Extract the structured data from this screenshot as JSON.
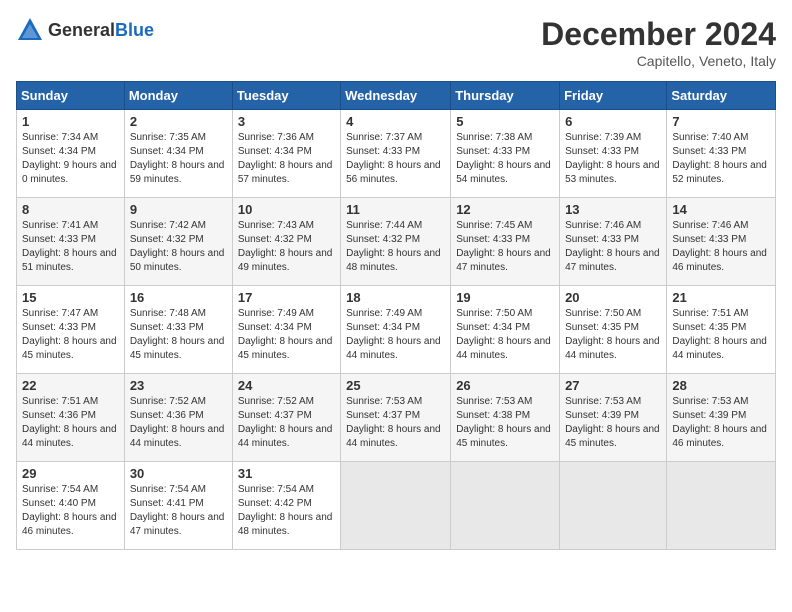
{
  "logo": {
    "text_general": "General",
    "text_blue": "Blue"
  },
  "title": "December 2024",
  "subtitle": "Capitello, Veneto, Italy",
  "headers": [
    "Sunday",
    "Monday",
    "Tuesday",
    "Wednesday",
    "Thursday",
    "Friday",
    "Saturday"
  ],
  "weeks": [
    [
      {
        "day": "1",
        "sunrise": "7:34 AM",
        "sunset": "4:34 PM",
        "daylight": "9 hours and 0 minutes."
      },
      {
        "day": "2",
        "sunrise": "7:35 AM",
        "sunset": "4:34 PM",
        "daylight": "8 hours and 59 minutes."
      },
      {
        "day": "3",
        "sunrise": "7:36 AM",
        "sunset": "4:34 PM",
        "daylight": "8 hours and 57 minutes."
      },
      {
        "day": "4",
        "sunrise": "7:37 AM",
        "sunset": "4:33 PM",
        "daylight": "8 hours and 56 minutes."
      },
      {
        "day": "5",
        "sunrise": "7:38 AM",
        "sunset": "4:33 PM",
        "daylight": "8 hours and 54 minutes."
      },
      {
        "day": "6",
        "sunrise": "7:39 AM",
        "sunset": "4:33 PM",
        "daylight": "8 hours and 53 minutes."
      },
      {
        "day": "7",
        "sunrise": "7:40 AM",
        "sunset": "4:33 PM",
        "daylight": "8 hours and 52 minutes."
      }
    ],
    [
      {
        "day": "8",
        "sunrise": "7:41 AM",
        "sunset": "4:33 PM",
        "daylight": "8 hours and 51 minutes."
      },
      {
        "day": "9",
        "sunrise": "7:42 AM",
        "sunset": "4:32 PM",
        "daylight": "8 hours and 50 minutes."
      },
      {
        "day": "10",
        "sunrise": "7:43 AM",
        "sunset": "4:32 PM",
        "daylight": "8 hours and 49 minutes."
      },
      {
        "day": "11",
        "sunrise": "7:44 AM",
        "sunset": "4:32 PM",
        "daylight": "8 hours and 48 minutes."
      },
      {
        "day": "12",
        "sunrise": "7:45 AM",
        "sunset": "4:33 PM",
        "daylight": "8 hours and 47 minutes."
      },
      {
        "day": "13",
        "sunrise": "7:46 AM",
        "sunset": "4:33 PM",
        "daylight": "8 hours and 47 minutes."
      },
      {
        "day": "14",
        "sunrise": "7:46 AM",
        "sunset": "4:33 PM",
        "daylight": "8 hours and 46 minutes."
      }
    ],
    [
      {
        "day": "15",
        "sunrise": "7:47 AM",
        "sunset": "4:33 PM",
        "daylight": "8 hours and 45 minutes."
      },
      {
        "day": "16",
        "sunrise": "7:48 AM",
        "sunset": "4:33 PM",
        "daylight": "8 hours and 45 minutes."
      },
      {
        "day": "17",
        "sunrise": "7:49 AM",
        "sunset": "4:34 PM",
        "daylight": "8 hours and 45 minutes."
      },
      {
        "day": "18",
        "sunrise": "7:49 AM",
        "sunset": "4:34 PM",
        "daylight": "8 hours and 44 minutes."
      },
      {
        "day": "19",
        "sunrise": "7:50 AM",
        "sunset": "4:34 PM",
        "daylight": "8 hours and 44 minutes."
      },
      {
        "day": "20",
        "sunrise": "7:50 AM",
        "sunset": "4:35 PM",
        "daylight": "8 hours and 44 minutes."
      },
      {
        "day": "21",
        "sunrise": "7:51 AM",
        "sunset": "4:35 PM",
        "daylight": "8 hours and 44 minutes."
      }
    ],
    [
      {
        "day": "22",
        "sunrise": "7:51 AM",
        "sunset": "4:36 PM",
        "daylight": "8 hours and 44 minutes."
      },
      {
        "day": "23",
        "sunrise": "7:52 AM",
        "sunset": "4:36 PM",
        "daylight": "8 hours and 44 minutes."
      },
      {
        "day": "24",
        "sunrise": "7:52 AM",
        "sunset": "4:37 PM",
        "daylight": "8 hours and 44 minutes."
      },
      {
        "day": "25",
        "sunrise": "7:53 AM",
        "sunset": "4:37 PM",
        "daylight": "8 hours and 44 minutes."
      },
      {
        "day": "26",
        "sunrise": "7:53 AM",
        "sunset": "4:38 PM",
        "daylight": "8 hours and 45 minutes."
      },
      {
        "day": "27",
        "sunrise": "7:53 AM",
        "sunset": "4:39 PM",
        "daylight": "8 hours and 45 minutes."
      },
      {
        "day": "28",
        "sunrise": "7:53 AM",
        "sunset": "4:39 PM",
        "daylight": "8 hours and 46 minutes."
      }
    ],
    [
      {
        "day": "29",
        "sunrise": "7:54 AM",
        "sunset": "4:40 PM",
        "daylight": "8 hours and 46 minutes."
      },
      {
        "day": "30",
        "sunrise": "7:54 AM",
        "sunset": "4:41 PM",
        "daylight": "8 hours and 47 minutes."
      },
      {
        "day": "31",
        "sunrise": "7:54 AM",
        "sunset": "4:42 PM",
        "daylight": "8 hours and 48 minutes."
      },
      null,
      null,
      null,
      null
    ]
  ],
  "labels": {
    "sunrise": "Sunrise:",
    "sunset": "Sunset:",
    "daylight": "Daylight:"
  }
}
